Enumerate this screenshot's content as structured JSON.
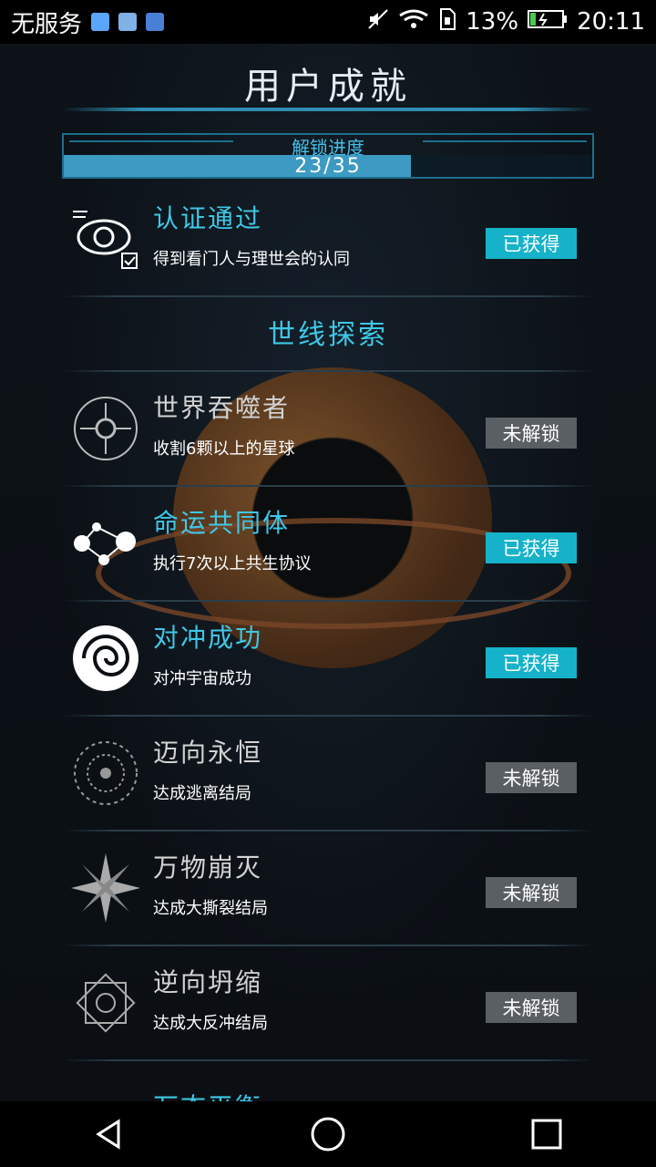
{
  "status_bar": {
    "carrier": "无服务",
    "battery": "13%",
    "time": "20:11"
  },
  "page": {
    "title": "用户成就"
  },
  "progress": {
    "label": "解锁进度",
    "text": "23/35",
    "unlocked": 23,
    "total": 35
  },
  "colors": {
    "accent": "#3ec8e6",
    "earned_badge": "#15b2c9",
    "locked_badge": "#5a5f63"
  },
  "achievements": [
    {
      "title": "认证通过",
      "desc": "得到看门人与理世会的认同",
      "badge": "已获得",
      "state": "earned",
      "icon": "eye-verify-icon"
    },
    {
      "title": "世界吞噬者",
      "desc": "收割6颗以上的星球",
      "badge": "未解锁",
      "state": "locked",
      "icon": "circuit-orb-icon"
    },
    {
      "title": "命运共同体",
      "desc": "执行7次以上共生协议",
      "badge": "已获得",
      "state": "earned",
      "icon": "linked-planets-icon"
    },
    {
      "title": "对冲成功",
      "desc": "对冲宇宙成功",
      "badge": "已获得",
      "state": "earned",
      "icon": "spiral-swirl-icon"
    },
    {
      "title": "迈向永恒",
      "desc": "达成逃离结局",
      "badge": "未解锁",
      "state": "locked",
      "icon": "vortex-icon"
    },
    {
      "title": "万物崩灭",
      "desc": "达成大撕裂结局",
      "badge": "未解锁",
      "state": "locked",
      "icon": "burst-icon"
    },
    {
      "title": "逆向坍缩",
      "desc": "达成大反冲结局",
      "badge": "未解锁",
      "state": "locked",
      "icon": "mandala-icon"
    }
  ],
  "section": {
    "title": "世线探索"
  },
  "peek_item": {
    "title": "万态平衡"
  }
}
